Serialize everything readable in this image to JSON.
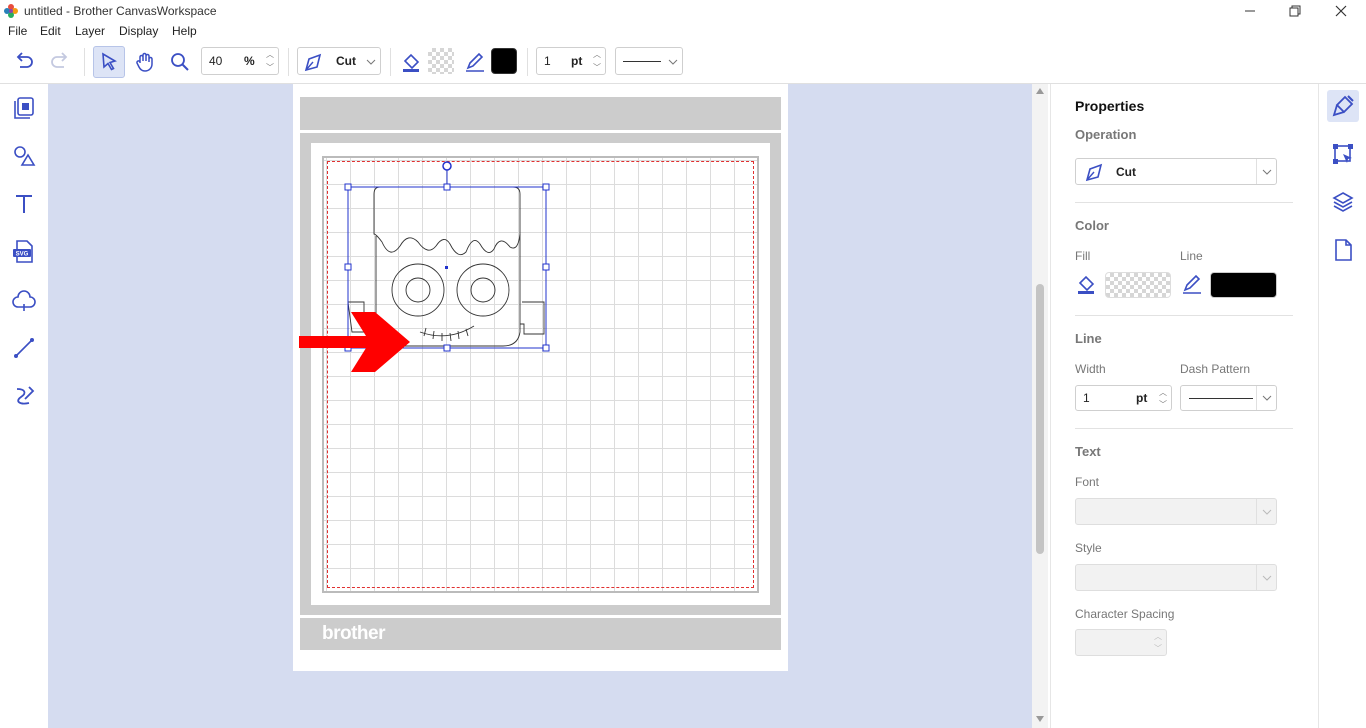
{
  "titlebar": {
    "title": "untitled - Brother CanvasWorkspace"
  },
  "menu": [
    "File",
    "Edit",
    "Layer",
    "Display",
    "Help"
  ],
  "toolbar": {
    "zoom_value": "40",
    "zoom_unit": "%",
    "operation": "Cut",
    "line_width": "1",
    "line_unit": "pt",
    "fill_color": "transparent",
    "line_color": "#000000"
  },
  "mat": {
    "brand": "brother"
  },
  "properties": {
    "title": "Properties",
    "operation_label": "Operation",
    "operation_value": "Cut",
    "color_label": "Color",
    "fill_label": "Fill",
    "line_label": "Line",
    "line_section": "Line",
    "width_label": "Width",
    "width_value": "1",
    "width_unit": "pt",
    "dash_label": "Dash Pattern",
    "text_section": "Text",
    "font_label": "Font",
    "style_label": "Style",
    "spacing_label": "Character Spacing"
  },
  "colors": {
    "accent": "#3b4fc4",
    "canvas_bg": "#d5dcf0",
    "arrow": "#ff0000",
    "selection": "#2233cc"
  }
}
